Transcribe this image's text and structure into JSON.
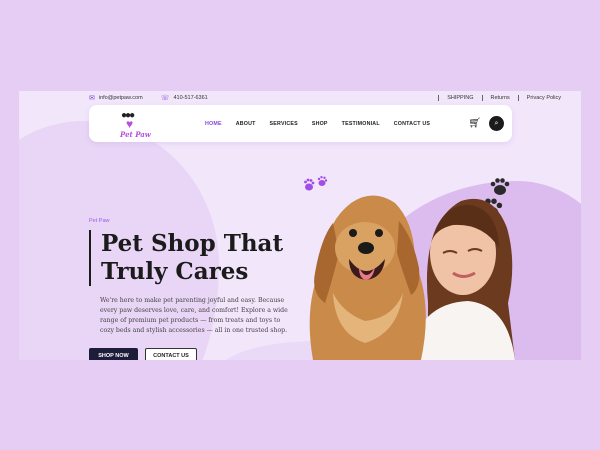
{
  "topbar": {
    "email": "info@petpaw.com",
    "phone": "410-517-6361",
    "links": [
      "SHIPPING",
      "Returns",
      "Privacy Policy"
    ]
  },
  "logo": {
    "text": "Pet Paw"
  },
  "nav": {
    "items": [
      "HOME",
      "ABOUT",
      "SERVICES",
      "SHOP",
      "TESTIMONIAL",
      "CONTACT US"
    ],
    "active": "HOME"
  },
  "hero": {
    "eyebrow": "Pet Paw",
    "title_line1": "Pet Shop That",
    "title_line2": "Truly Cares",
    "body": "We're here to make pet parenting joyful and easy. Because every paw deserves love, care, and comfort! Explore a wide range of premium pet products — from treats and toys to cozy beds and stylish accessories — all in one trusted shop.",
    "shop_button": "SHOP NOW",
    "contact_button": "CONTACT US"
  },
  "colors": {
    "page_bg": "#e6cdf3",
    "accent": "#8a44e0",
    "dark_button": "#1d1c3b"
  },
  "icons": [
    "mail-icon",
    "phone-icon",
    "cart-icon",
    "search-icon",
    "paw-print-icon"
  ]
}
